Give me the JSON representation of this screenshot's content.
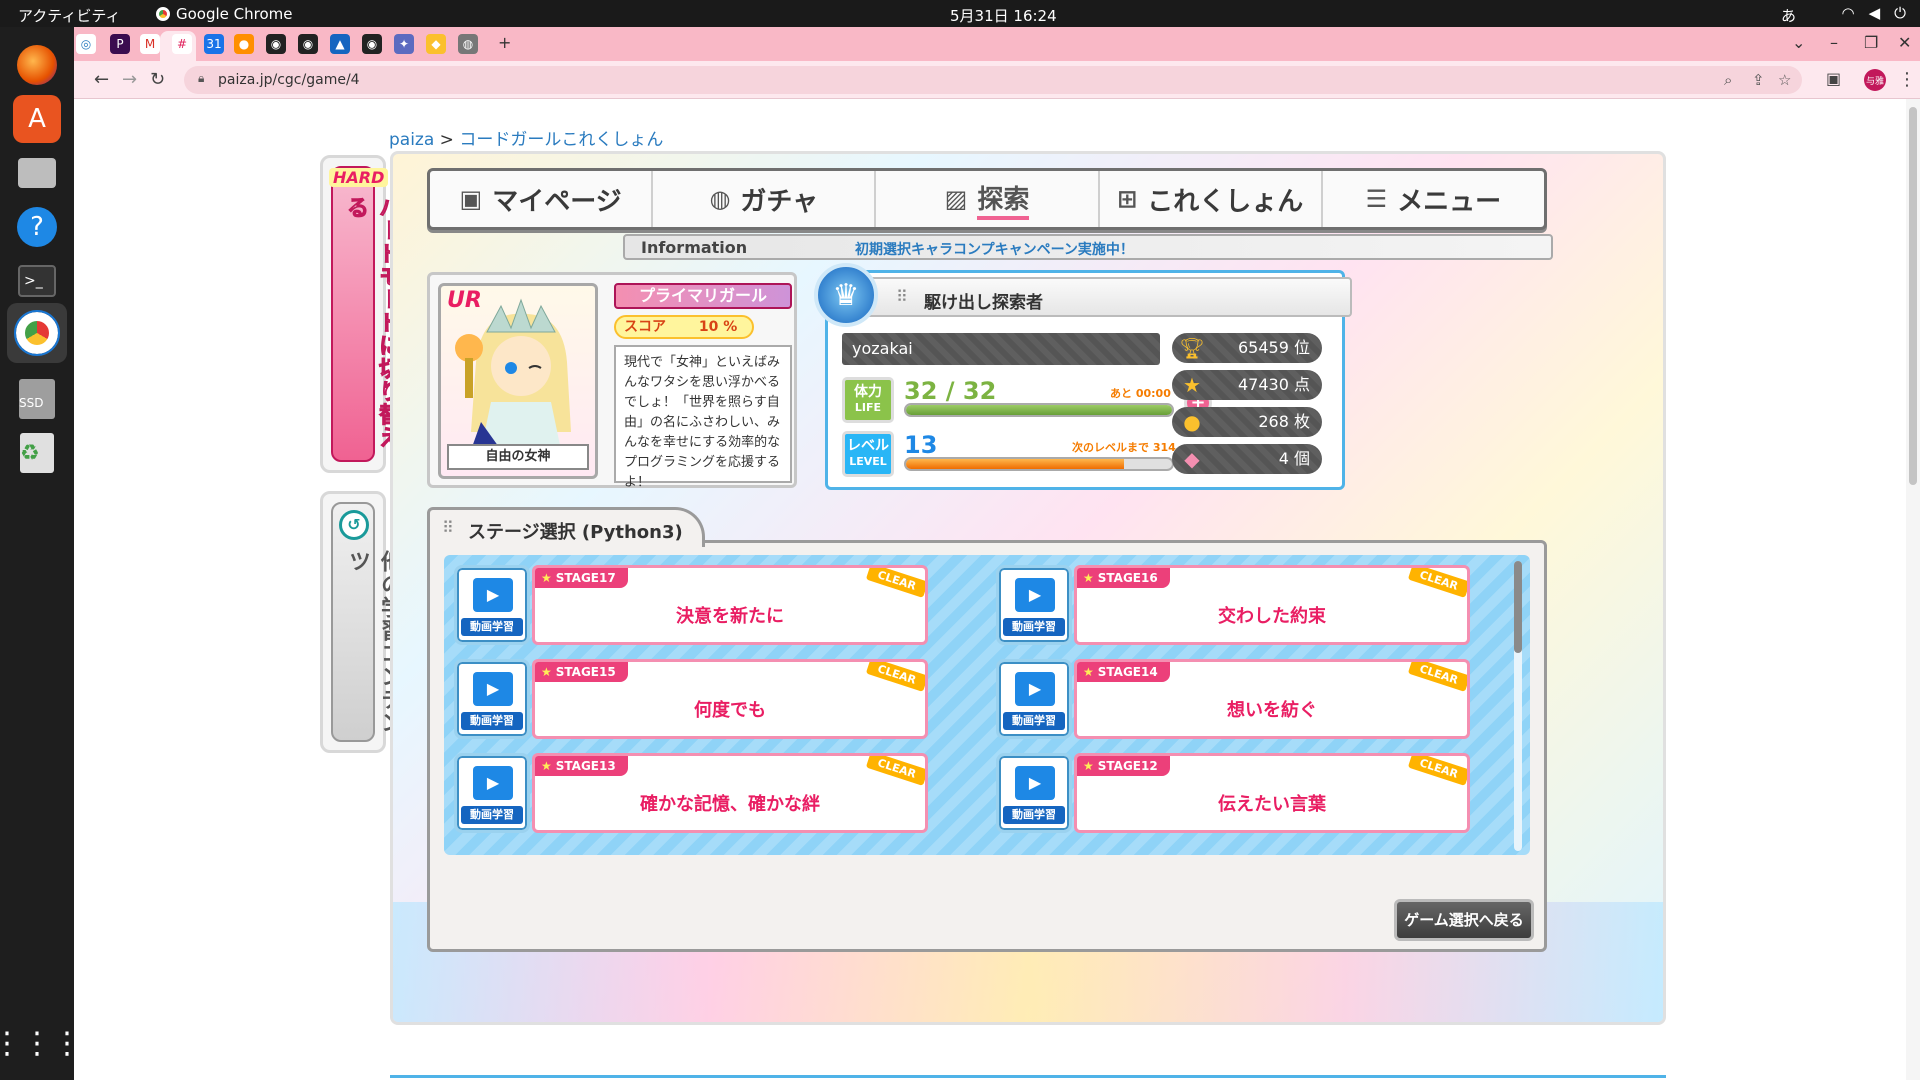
{
  "system": {
    "activities": "アクティビティ",
    "app_name": "Google Chrome",
    "clock": "5月31日  16:24",
    "ime": "あ"
  },
  "browser": {
    "url": "paiza.jp/cgc/game/4",
    "profile": "与雅"
  },
  "page": {
    "breadcrumb_root": "paiza",
    "breadcrumb_sep": " > ",
    "breadcrumb_current": "コードガールこれくしょん",
    "hard_mode": "ハードモードに切り替える",
    "hard_badge": "HARD",
    "other_content": "他の学習コンテンツ"
  },
  "menu": {
    "items": [
      {
        "label": "マイページ",
        "icon": "person-icon"
      },
      {
        "label": "ガチャ",
        "icon": "gacha-icon"
      },
      {
        "label": "探索",
        "icon": "map-icon"
      },
      {
        "label": "これくしょん",
        "icon": "grid-icon"
      },
      {
        "label": "メニュー",
        "icon": "list-icon"
      }
    ],
    "active_index": 2,
    "info_label": "Information",
    "info_message": "初期選択キャラコンプキャンペーン実施中！"
  },
  "character": {
    "rarity": "UR",
    "name": "自由の女神",
    "type_label": "プライマリガール",
    "score_label": "スコア",
    "score_value": "10 %",
    "description": "現代で「女神」といえばみんなワタシを思い浮かべるでしょ！「世界を照らす自由」の名にふさわしい、みんなを幸せにする効率的なプログラミングを応援するよ！"
  },
  "player": {
    "title": "駆け出し探索者",
    "username": "yozakai",
    "life_label_jp": "体力",
    "life_label_en": "LIFE",
    "life_value": "32 / 32",
    "life_note": "あと 00:00",
    "life_fraction": 1.0,
    "level_label_jp": "レベル",
    "level_label_en": "LEVEL",
    "level_value": "13",
    "level_note": "次のレベルまで 314",
    "level_fraction": 0.82,
    "rank": "65459 位",
    "points": "47430 点",
    "coins": "268 枚",
    "gems": "4 個"
  },
  "stages": {
    "heading": "ステージ選択 (Python3)",
    "video_label": "動画学習",
    "clear_label": "CLEAR",
    "items": [
      {
        "stage": "STAGE17",
        "title": "決意を新たに"
      },
      {
        "stage": "STAGE16",
        "title": "交わした約束"
      },
      {
        "stage": "STAGE15",
        "title": "何度でも"
      },
      {
        "stage": "STAGE14",
        "title": "想いを紡ぐ"
      },
      {
        "stage": "STAGE13",
        "title": "確かな記憶、確かな絆"
      },
      {
        "stage": "STAGE12",
        "title": "伝えたい言葉"
      }
    ],
    "back_button": "ゲーム選択へ戻る"
  },
  "colors": {
    "tab_strip": "#f9b8c6",
    "accent_pink": "#e91e63",
    "accent_blue": "#2a7bbf"
  }
}
